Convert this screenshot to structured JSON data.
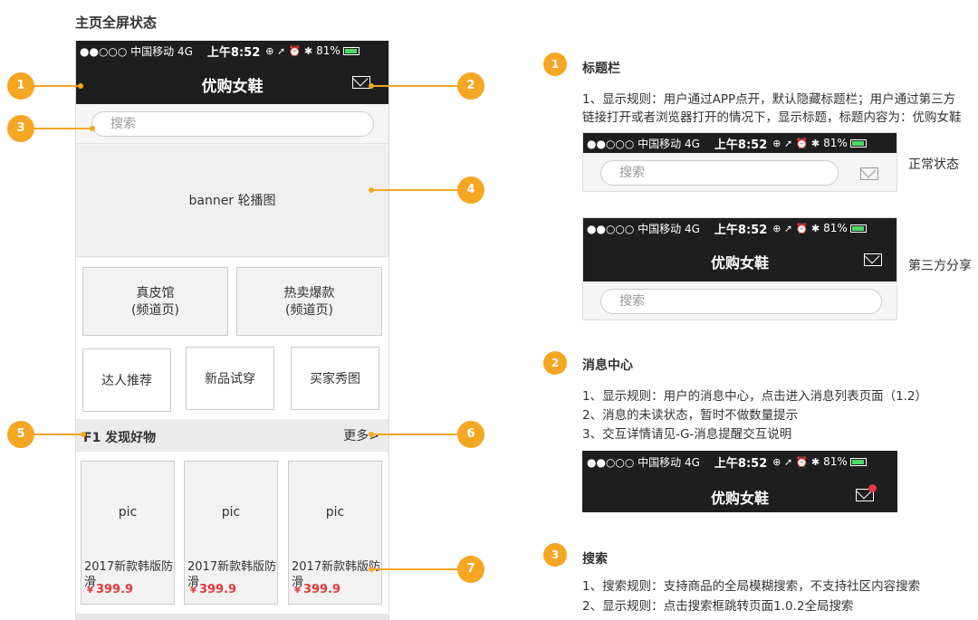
{
  "page_title": "主页全屏状态",
  "statusbar": {
    "signal": "●●○○○ 中国移动  4G",
    "time": "上午8:52",
    "icons": "⊕ ➚ ⏰ ✱",
    "battery": "81%"
  },
  "app": {
    "title": "优购女鞋",
    "search_placeholder": "搜索",
    "banner_label": "banner 轮播图",
    "categories_big": [
      {
        "name": "真皮馆",
        "sub": "(频道页)"
      },
      {
        "name": "热卖爆款",
        "sub": "(频道页)"
      }
    ],
    "categories_small": [
      "达人推荐",
      "新品试穿",
      "买家秀图"
    ],
    "floor": {
      "title": "F1  发现好物",
      "more": "更多>"
    },
    "products": [
      {
        "pic": "pic",
        "name": "2017新款韩版防滑",
        "currency": "¥",
        "price": "399.9"
      },
      {
        "pic": "pic",
        "name": "2017新款韩版防滑",
        "currency": "¥",
        "price": "399.9"
      },
      {
        "pic": "pic",
        "name": "2017新款韩版防滑",
        "currency": "¥",
        "price": "399.9"
      }
    ]
  },
  "callouts": [
    "1",
    "2",
    "3",
    "4",
    "5",
    "6",
    "7"
  ],
  "notes": [
    {
      "number": "1",
      "title": "标题栏",
      "lines": [
        "1、显示规则：用户通过APP点开，默认隐藏标题栏；用户通过第三方",
        "链接打开或者浏览器打开的情况下，显示标题，标题内容为：优购女鞋"
      ],
      "mock_labels": [
        "正常状态",
        "第三方分享"
      ]
    },
    {
      "number": "2",
      "title": "消息中心",
      "lines": [
        "1、显示规则：用户的消息中心，点击进入消息列表页面（1.2）",
        "2、消息的未读状态，暂时不做数量提示",
        "3、交互详情请见-G-消息提醒交互说明"
      ]
    },
    {
      "number": "3",
      "title": "搜索",
      "lines": [
        "1、搜索规则：支持商品的全局模糊搜索，不支持社区内容搜索",
        "2、显示规则：点击搜索框跳转页面1.0.2全局搜索"
      ]
    }
  ],
  "colors": {
    "accent": "#f5a623",
    "dark_bar": "#1e1e1e",
    "price": "#e4393c"
  }
}
